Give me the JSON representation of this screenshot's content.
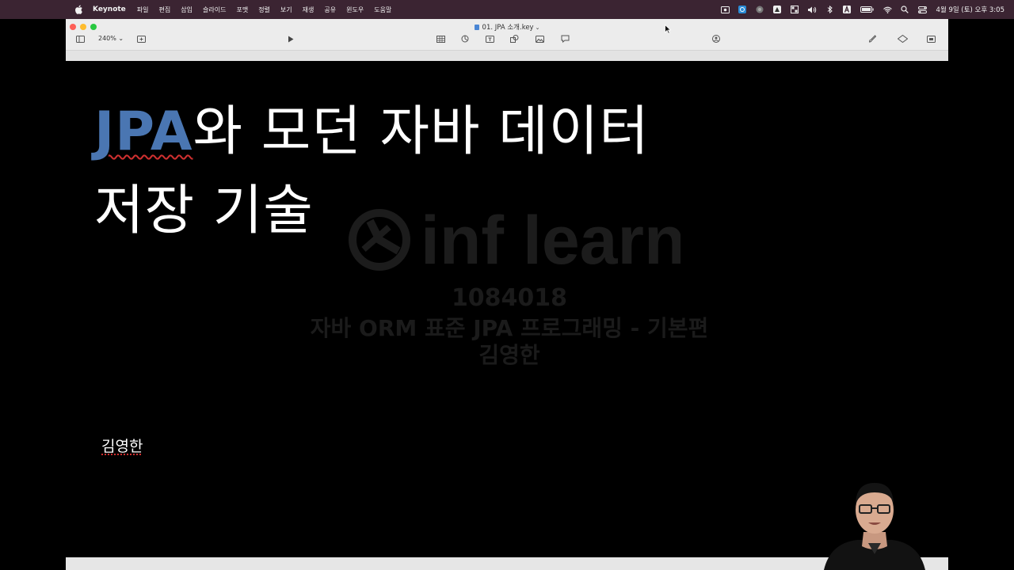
{
  "menubar": {
    "app_name": "Keynote",
    "menus": [
      "파일",
      "편집",
      "삽입",
      "슬라이드",
      "포맷",
      "정렬",
      "보기",
      "재생",
      "공유",
      "윈도우",
      "도움말"
    ],
    "clock": "4월 9일 (토) 오후 3:05"
  },
  "window": {
    "document_title": "01. JPA 소개.key",
    "zoom": "240%"
  },
  "slide": {
    "title_part1": "JPA",
    "title_part2": "와 모던 자바 데이터",
    "title_line2": "저장 기술",
    "author": "김영한"
  },
  "watermark": {
    "brand": "inf learn",
    "id": "1084018",
    "course": "자바 ORM 표준 JPA 프로그래밍 - 기본편",
    "name": "김영한"
  },
  "colors": {
    "menubar_bg": "#3b2432",
    "title_accent": "#4a76b2",
    "spell_underline": "#d03030"
  }
}
